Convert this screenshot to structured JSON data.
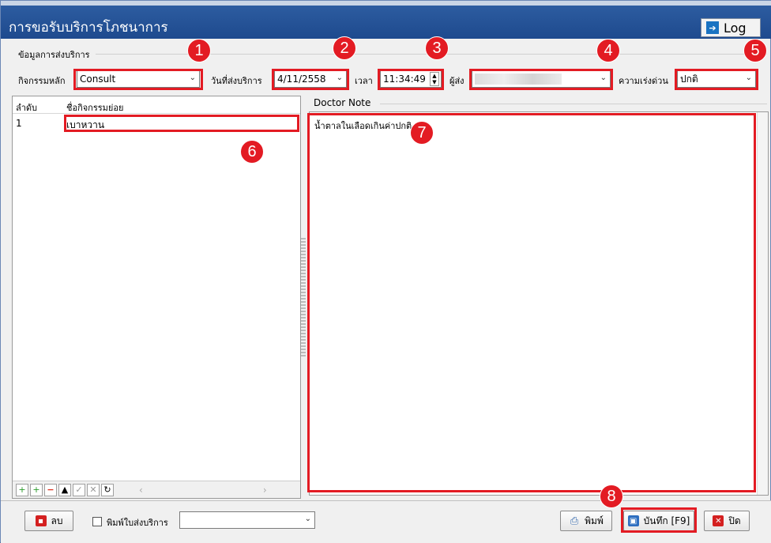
{
  "window": {
    "title": "การขอรับบริการโภชนาการ",
    "log_label": "Log"
  },
  "group": {
    "label": "ข้อมูลการส่งบริการ"
  },
  "fields": {
    "main_activity": {
      "label": "กิจกรรมหลัก",
      "value": "Consult"
    },
    "service_date": {
      "label": "วันที่ส่งบริการ",
      "value": "4/11/2558"
    },
    "time": {
      "label": "เวลา",
      "value": "11:34:49"
    },
    "sender": {
      "label": "ผู้ส่ง",
      "value": ""
    },
    "urgency": {
      "label": "ความเร่งด่วน",
      "value": "ปกติ"
    }
  },
  "activity_table": {
    "headers": [
      "ลำดับ",
      "ชื่อกิจกรรมย่อย"
    ],
    "rows": [
      {
        "no": "1",
        "name": "เบาหวาน"
      }
    ]
  },
  "doctor_note": {
    "label": "Doctor Note",
    "text": "น้ำตาลในเลือดเกินค่าปกติ"
  },
  "bottom": {
    "delete_label": "ลบ",
    "print_slip_label": "พิมพ์ใบส่งบริการ",
    "print_slip_value": "",
    "print_label": "พิมพ์",
    "save_label": "บันทึก [F9]",
    "close_label": "ปิด"
  },
  "badges": [
    "1",
    "2",
    "3",
    "4",
    "5",
    "6",
    "7",
    "8"
  ],
  "colors": {
    "title_bar": "#1e4a8e",
    "highlight": "#e31b23"
  }
}
